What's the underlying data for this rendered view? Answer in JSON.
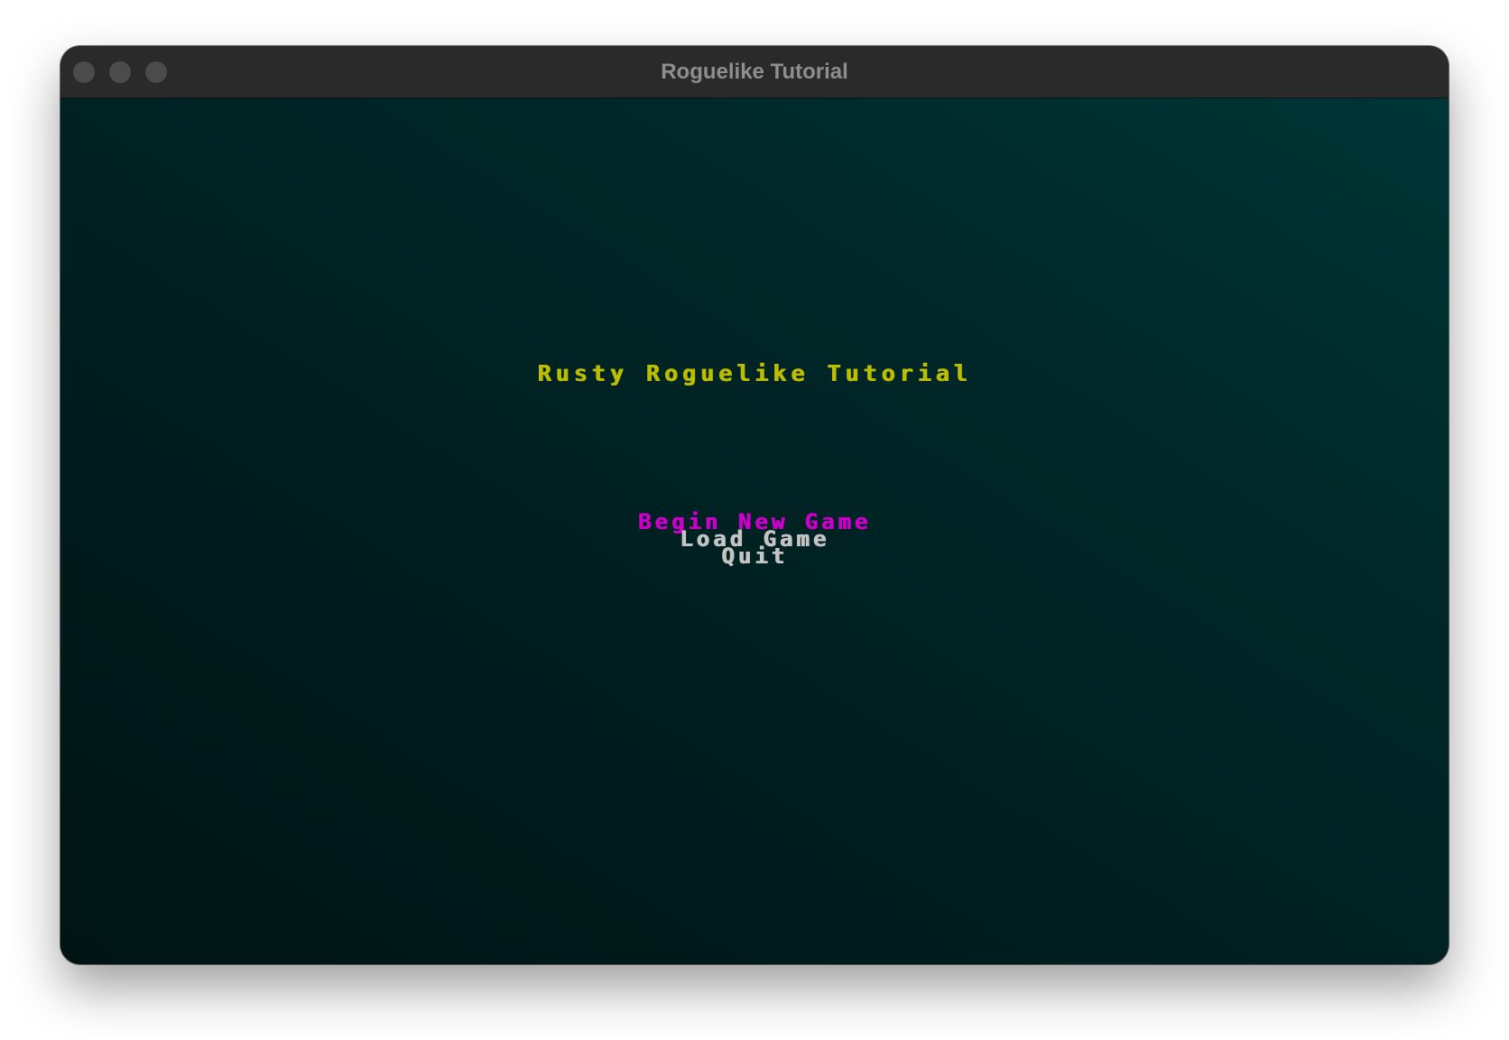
{
  "window": {
    "title": "Roguelike Tutorial",
    "controls": [
      "close-icon",
      "minimize-icon",
      "zoom-icon"
    ]
  },
  "game": {
    "title": "Rusty Roguelike Tutorial",
    "menu": [
      {
        "label": "Begin New Game",
        "selected": true
      },
      {
        "label": "Load Game",
        "selected": false
      },
      {
        "label": "Quit",
        "selected": false
      }
    ]
  },
  "colors": {
    "title": "#bdbd00",
    "selected_item": "#c800c8",
    "menu_item": "#c4c4c4",
    "background_top": "#003636",
    "background_bottom": "#001414"
  }
}
